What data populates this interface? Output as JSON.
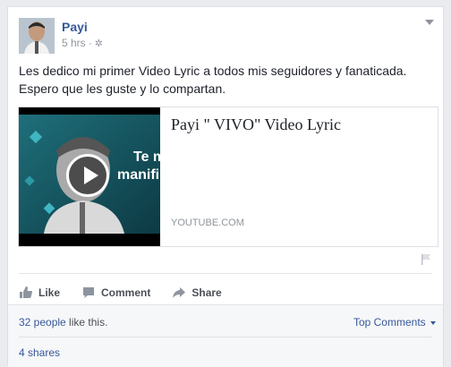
{
  "post": {
    "author": "Payi",
    "time": "5 hrs",
    "separator": "·",
    "privacy_icon": "gear-icon",
    "text": "Les dedico mi primer Video Lyric a todos mis seguidores y fanaticada. Espero que les guste y lo compartan."
  },
  "link": {
    "title": "Payi \" VIVO\" Video Lyric",
    "domain": "YOUTUBE.COM",
    "thumb_overlay": "Te m\nmanifi"
  },
  "actions": {
    "like": "Like",
    "comment": "Comment",
    "share": "Share"
  },
  "footer": {
    "likes_people": "32 people",
    "likes_suffix": " like this.",
    "top_comments": "Top Comments",
    "shares": "4 shares"
  },
  "colors": {
    "link_blue": "#365899",
    "muted": "#90949c",
    "text": "#1d2129"
  }
}
